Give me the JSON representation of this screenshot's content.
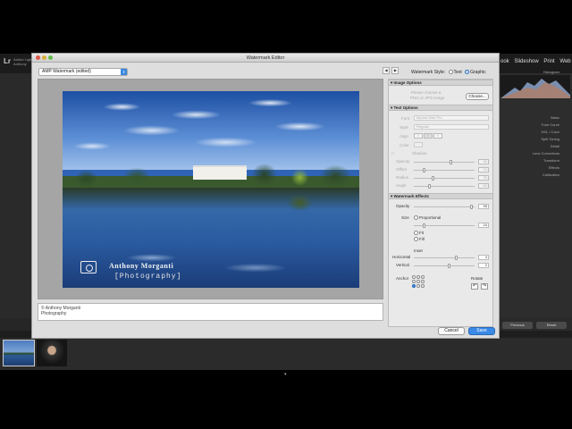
{
  "app": {
    "logo": "Lr",
    "user_line1": "Adobe Lightroom",
    "user_line2": "Anthony",
    "modules": [
      "ook",
      "Slideshow",
      "Print",
      "Web"
    ],
    "right_panel": [
      "Histogram",
      "Basic",
      "Tone Curve",
      "HSL / Color",
      "Split Toning",
      "Detail",
      "Lens Corrections",
      "Transform",
      "Effects",
      "Calibration"
    ],
    "previous_label": "Previous",
    "reset_label": "Reset"
  },
  "dialog": {
    "title": "Watermark Editor",
    "preset": "AMP Watermark (edited)",
    "nav": [
      "◀",
      "▶"
    ],
    "style_label": "Watermark Style:",
    "style_options": [
      "Text",
      "Graphic"
    ],
    "style_selected": "Graphic",
    "preview_text_line1": "© Anthony Morganti",
    "preview_text_line2": "Photography",
    "watermark_name": "Anthony Morganti",
    "watermark_sub": "[Photography]",
    "cancel_label": "Cancel",
    "save_label": "Save"
  },
  "panel": {
    "image_options": {
      "header": "Image Options",
      "hint_line1": "Please choose a",
      "hint_line2": "PNG or JPG image",
      "choose_label": "Choose..."
    },
    "text_options": {
      "header": "Text Options",
      "font_label": "Font",
      "font_value": "Myriad Web Pro",
      "style_label": "Style",
      "style_value": "Regular",
      "align_label": "Align",
      "color_label": "Color",
      "shadow_label": "Shadow",
      "opacity_label": "Opacity",
      "opacity_value": "60",
      "offset_label": "Offset",
      "offset_value": "10",
      "radius_label": "Radius",
      "radius_value": "25",
      "angle_label": "Angle",
      "angle_value": "-90"
    },
    "effects": {
      "header": "Watermark Effects",
      "opacity_label": "Opacity",
      "opacity_value": "95",
      "size_label": "Size",
      "size_options": [
        "Proportional",
        "Fit",
        "Fill"
      ],
      "size_selected": "Proportional",
      "size_value": "24",
      "inset_label": "Inset",
      "horizontal_label": "Horizontal",
      "horizontal_value": "4",
      "vertical_label": "Vertical",
      "vertical_value": "2",
      "anchor_label": "Anchor",
      "rotate_label": "Rotate"
    }
  }
}
